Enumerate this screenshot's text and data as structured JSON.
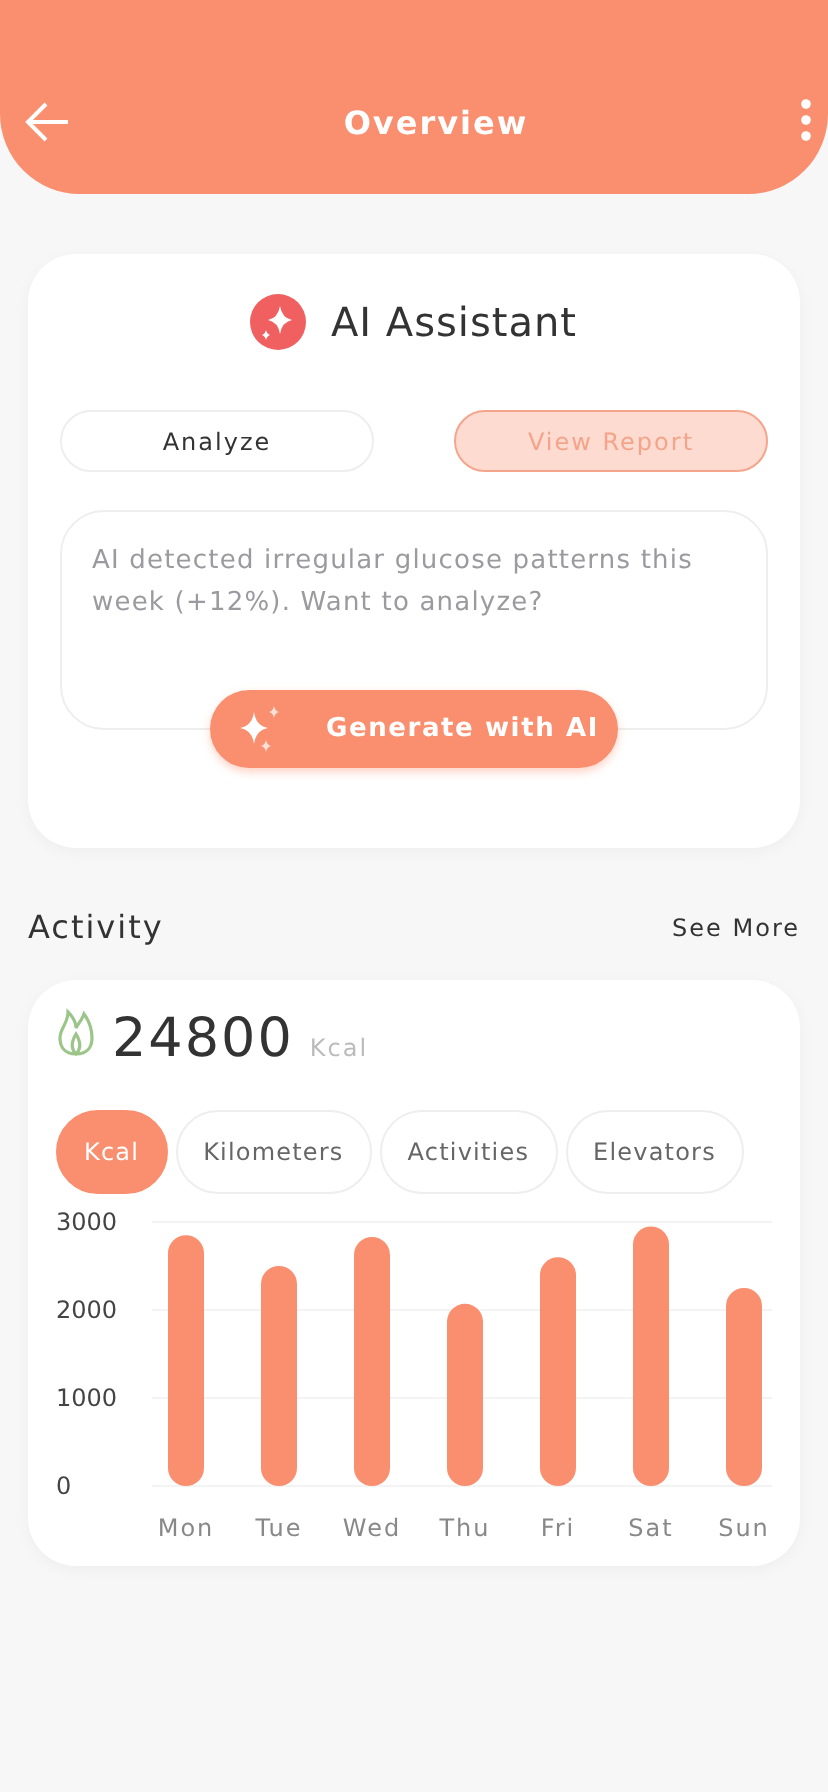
{
  "header": {
    "title": "Overview"
  },
  "assistant": {
    "title": "AI Assistant",
    "actions": [
      {
        "label": "Analyze",
        "selected": false
      },
      {
        "label": "View Report",
        "selected": true
      }
    ],
    "prompt": {
      "placeholder": "AI detected irregular glucose patterns this week (+12%). Want to analyze?"
    },
    "generate_button": "Generate with AI"
  },
  "activity": {
    "title": "Activity",
    "see_more": "See More",
    "total": "24800",
    "unit": "Kcal",
    "tabs": [
      {
        "label": "Kcal",
        "selected": true
      },
      {
        "label": "Kilometers",
        "selected": false
      },
      {
        "label": "Activities",
        "selected": false
      },
      {
        "label": "Elevators",
        "selected": false
      }
    ],
    "chart_data": {
      "type": "bar",
      "categories": [
        "Mon",
        "Tue",
        "Wed",
        "Thu",
        "Fri",
        "Sat",
        "Sun"
      ],
      "series": [
        {
          "color": "#f98f6f",
          "values": [
            2850,
            2500,
            2830,
            2070,
            2600,
            2950,
            2250
          ]
        }
      ],
      "ylim": [
        0,
        3000
      ],
      "yticks": [
        0,
        1000,
        2000,
        3000
      ]
    }
  }
}
